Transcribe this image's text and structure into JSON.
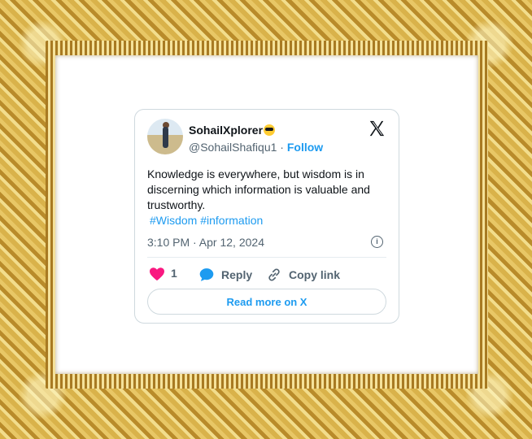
{
  "tweet": {
    "display_name": "SohailXplorer",
    "handle": "@SohailShafiqu1",
    "separator": "·",
    "follow_label": "Follow",
    "text": "Knowledge is everywhere, but wisdom is in discerning which information is valuable and trustworthy.",
    "hashtags": "#Wisdom #information",
    "timestamp": "3:10 PM · Apr 12, 2024",
    "info_glyph": "i",
    "like_count": "1",
    "reply_label": "Reply",
    "copy_link_label": "Copy link",
    "read_more_label": "Read more on X"
  },
  "icons": {
    "logo": "x-logo-icon",
    "like": "heart-icon",
    "reply": "speech-bubble-icon",
    "copy": "link-icon",
    "info": "info-icon",
    "emoji": "sunglasses-emoji-icon"
  },
  "colors": {
    "accent": "#1d9bf0",
    "like": "#f91880",
    "text": "#0f1419",
    "secondary": "#536471",
    "frame_gold": "#d9b24a"
  }
}
